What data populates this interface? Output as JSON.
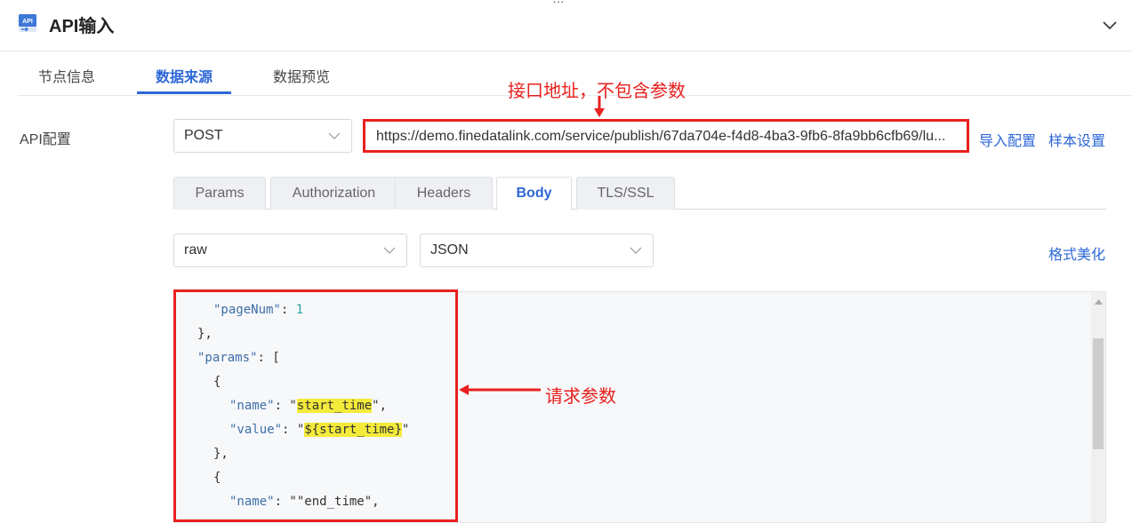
{
  "header": {
    "title": "API输入",
    "icon": "api-icon",
    "icon_text": "API",
    "top_dots": "..."
  },
  "tabs": [
    {
      "label": "节点信息",
      "active": false
    },
    {
      "label": "数据来源",
      "active": true
    },
    {
      "label": "数据预览",
      "active": false
    }
  ],
  "annotations": {
    "url_note": "接口地址，不包含参数",
    "params_note": "请求参数"
  },
  "api_config": {
    "label": "API配置",
    "method": "POST",
    "url": "https://demo.finedatalink.com/service/publish/67da704e-f4d8-4ba3-9fb6-8fa9bb6cfb69/lu...",
    "import_label": "导入配置",
    "sample_label": "样本设置"
  },
  "request_tabs": [
    {
      "label": "Params",
      "active": false
    },
    {
      "label": "Authorization",
      "active": false
    },
    {
      "label": "Headers",
      "active": false
    },
    {
      "label": "Body",
      "active": true
    },
    {
      "label": "TLS/SSL",
      "active": false
    }
  ],
  "body": {
    "mode": "raw",
    "type": "JSON",
    "format_label": "格式美化",
    "code": {
      "page_num_key": "\"pageNum\"",
      "page_num_val": "1",
      "close_obj": "},",
      "params_key": "\"params\"",
      "params_open": ": [",
      "open_brace": "{",
      "name_key": "\"name\"",
      "value_key": "\"value\"",
      "start_name": "start_time",
      "start_value": "${start_time}",
      "end_name": "\"end_time\",",
      "colon_quote": ": \"",
      "quote_comma": "\",",
      "quote": "\"",
      "colon_sep": ": "
    }
  },
  "colors": {
    "accent": "#2d67d8",
    "annotation_red": "#e8201e",
    "highlight": "#f4ea3a"
  }
}
